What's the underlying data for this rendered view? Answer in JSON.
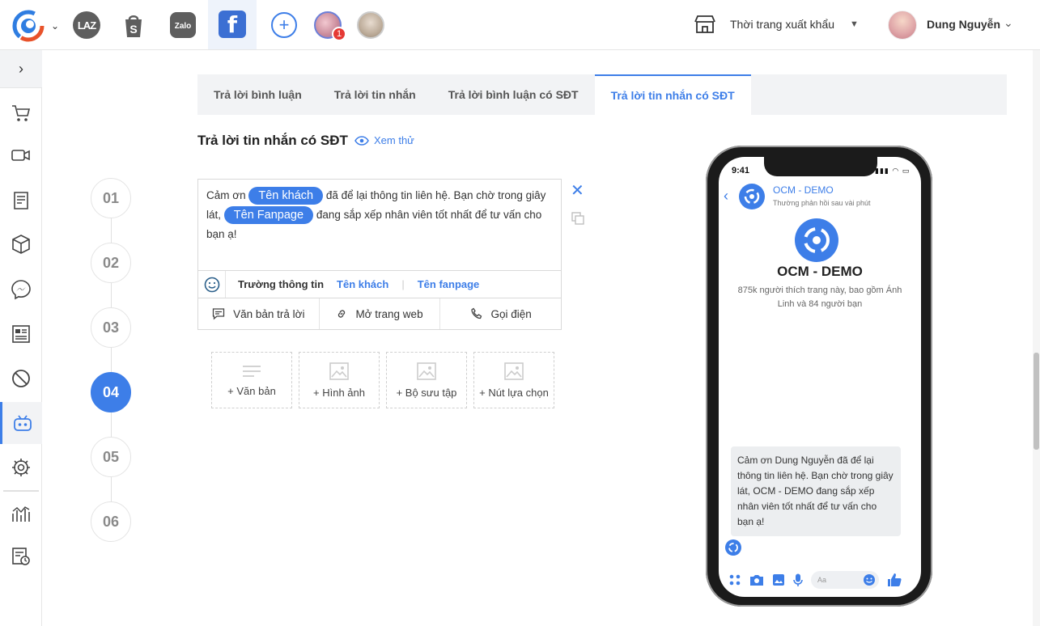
{
  "topbar": {
    "channels": [
      "LAZ"
    ],
    "notification_count": "1",
    "store_name": "Thời trang xuất khẩu",
    "user_name": "Dung Nguyễn",
    "facebook_glyph": "f",
    "plus_glyph": "+"
  },
  "sidebar": {
    "toggle": "›",
    "icons": [
      "cart-icon",
      "video-icon",
      "order-list-icon",
      "box-icon",
      "messenger-icon",
      "form-icon",
      "block-icon",
      "bot-icon",
      "settings-icon",
      "chart-icon",
      "report-icon"
    ]
  },
  "tabs": [
    "Trả lời bình luận",
    "Trả lời tin nhắn",
    "Trả lời bình luận có SĐT",
    "Trả lời tin nhắn có SĐT"
  ],
  "section": {
    "title": "Trả lời tin nhắn có SĐT",
    "preview": "Xem thử"
  },
  "steps": [
    "01",
    "02",
    "03",
    "04",
    "05",
    "06"
  ],
  "editor": {
    "t1": "Cảm ơn",
    "chip1": "Tên khách",
    "t2": "đã để lại thông tin liên hệ. Bạn chờ trong giây lát,",
    "chip2": "Tên Fanpage",
    "t3": "đang sắp xếp nhân viên tốt nhất để tư vấn cho bạn ạ!",
    "field_label": "Trường thông tin",
    "field_customer": "Tên khách",
    "field_fanpage": "Tên fanpage",
    "sep": "|"
  },
  "buttons": [
    "Văn bản trả lời",
    "Mở trang web",
    "Gọi điện"
  ],
  "add_blocks": [
    "+ Văn bản",
    "+ Hình ảnh",
    "+ Bộ sưu tập",
    "+ Nút lựa chọn"
  ],
  "phone": {
    "time": "9:41",
    "page_name": "OCM - DEMO",
    "response": "Thường phản hồi sau vài phút",
    "title": "OCM - DEMO",
    "desc": "875k người thích trang này, bao gồm Ánh Linh và 84 người bạn",
    "message": "Cảm ơn Dung Nguyễn đã để lại thông tin liên hệ. Bạn chờ trong giây lát, OCM - DEMO đang sắp xếp nhân viên tốt nhất để tư vấn cho bạn ạ!",
    "input_placeholder": "Aa"
  },
  "colors": {
    "accent": "#3d7ee8",
    "facebook": "#3b6fd3",
    "badge": "#e53935"
  }
}
